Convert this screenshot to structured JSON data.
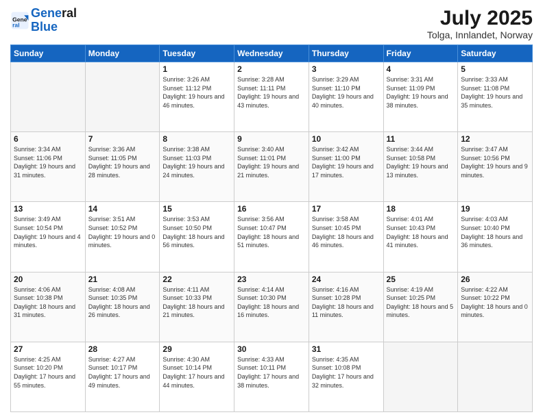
{
  "header": {
    "logo_line1": "General",
    "logo_line2": "Blue",
    "month_title": "July 2025",
    "location": "Tolga, Innlandet, Norway"
  },
  "days_of_week": [
    "Sunday",
    "Monday",
    "Tuesday",
    "Wednesday",
    "Thursday",
    "Friday",
    "Saturday"
  ],
  "weeks": [
    [
      {
        "day": "",
        "info": ""
      },
      {
        "day": "",
        "info": ""
      },
      {
        "day": "1",
        "info": "Sunrise: 3:26 AM\nSunset: 11:12 PM\nDaylight: 19 hours and 46 minutes."
      },
      {
        "day": "2",
        "info": "Sunrise: 3:28 AM\nSunset: 11:11 PM\nDaylight: 19 hours and 43 minutes."
      },
      {
        "day": "3",
        "info": "Sunrise: 3:29 AM\nSunset: 11:10 PM\nDaylight: 19 hours and 40 minutes."
      },
      {
        "day": "4",
        "info": "Sunrise: 3:31 AM\nSunset: 11:09 PM\nDaylight: 19 hours and 38 minutes."
      },
      {
        "day": "5",
        "info": "Sunrise: 3:33 AM\nSunset: 11:08 PM\nDaylight: 19 hours and 35 minutes."
      }
    ],
    [
      {
        "day": "6",
        "info": "Sunrise: 3:34 AM\nSunset: 11:06 PM\nDaylight: 19 hours and 31 minutes."
      },
      {
        "day": "7",
        "info": "Sunrise: 3:36 AM\nSunset: 11:05 PM\nDaylight: 19 hours and 28 minutes."
      },
      {
        "day": "8",
        "info": "Sunrise: 3:38 AM\nSunset: 11:03 PM\nDaylight: 19 hours and 24 minutes."
      },
      {
        "day": "9",
        "info": "Sunrise: 3:40 AM\nSunset: 11:01 PM\nDaylight: 19 hours and 21 minutes."
      },
      {
        "day": "10",
        "info": "Sunrise: 3:42 AM\nSunset: 11:00 PM\nDaylight: 19 hours and 17 minutes."
      },
      {
        "day": "11",
        "info": "Sunrise: 3:44 AM\nSunset: 10:58 PM\nDaylight: 19 hours and 13 minutes."
      },
      {
        "day": "12",
        "info": "Sunrise: 3:47 AM\nSunset: 10:56 PM\nDaylight: 19 hours and 9 minutes."
      }
    ],
    [
      {
        "day": "13",
        "info": "Sunrise: 3:49 AM\nSunset: 10:54 PM\nDaylight: 19 hours and 4 minutes."
      },
      {
        "day": "14",
        "info": "Sunrise: 3:51 AM\nSunset: 10:52 PM\nDaylight: 19 hours and 0 minutes."
      },
      {
        "day": "15",
        "info": "Sunrise: 3:53 AM\nSunset: 10:50 PM\nDaylight: 18 hours and 56 minutes."
      },
      {
        "day": "16",
        "info": "Sunrise: 3:56 AM\nSunset: 10:47 PM\nDaylight: 18 hours and 51 minutes."
      },
      {
        "day": "17",
        "info": "Sunrise: 3:58 AM\nSunset: 10:45 PM\nDaylight: 18 hours and 46 minutes."
      },
      {
        "day": "18",
        "info": "Sunrise: 4:01 AM\nSunset: 10:43 PM\nDaylight: 18 hours and 41 minutes."
      },
      {
        "day": "19",
        "info": "Sunrise: 4:03 AM\nSunset: 10:40 PM\nDaylight: 18 hours and 36 minutes."
      }
    ],
    [
      {
        "day": "20",
        "info": "Sunrise: 4:06 AM\nSunset: 10:38 PM\nDaylight: 18 hours and 31 minutes."
      },
      {
        "day": "21",
        "info": "Sunrise: 4:08 AM\nSunset: 10:35 PM\nDaylight: 18 hours and 26 minutes."
      },
      {
        "day": "22",
        "info": "Sunrise: 4:11 AM\nSunset: 10:33 PM\nDaylight: 18 hours and 21 minutes."
      },
      {
        "day": "23",
        "info": "Sunrise: 4:14 AM\nSunset: 10:30 PM\nDaylight: 18 hours and 16 minutes."
      },
      {
        "day": "24",
        "info": "Sunrise: 4:16 AM\nSunset: 10:28 PM\nDaylight: 18 hours and 11 minutes."
      },
      {
        "day": "25",
        "info": "Sunrise: 4:19 AM\nSunset: 10:25 PM\nDaylight: 18 hours and 5 minutes."
      },
      {
        "day": "26",
        "info": "Sunrise: 4:22 AM\nSunset: 10:22 PM\nDaylight: 18 hours and 0 minutes."
      }
    ],
    [
      {
        "day": "27",
        "info": "Sunrise: 4:25 AM\nSunset: 10:20 PM\nDaylight: 17 hours and 55 minutes."
      },
      {
        "day": "28",
        "info": "Sunrise: 4:27 AM\nSunset: 10:17 PM\nDaylight: 17 hours and 49 minutes."
      },
      {
        "day": "29",
        "info": "Sunrise: 4:30 AM\nSunset: 10:14 PM\nDaylight: 17 hours and 44 minutes."
      },
      {
        "day": "30",
        "info": "Sunrise: 4:33 AM\nSunset: 10:11 PM\nDaylight: 17 hours and 38 minutes."
      },
      {
        "day": "31",
        "info": "Sunrise: 4:35 AM\nSunset: 10:08 PM\nDaylight: 17 hours and 32 minutes."
      },
      {
        "day": "",
        "info": ""
      },
      {
        "day": "",
        "info": ""
      }
    ]
  ]
}
